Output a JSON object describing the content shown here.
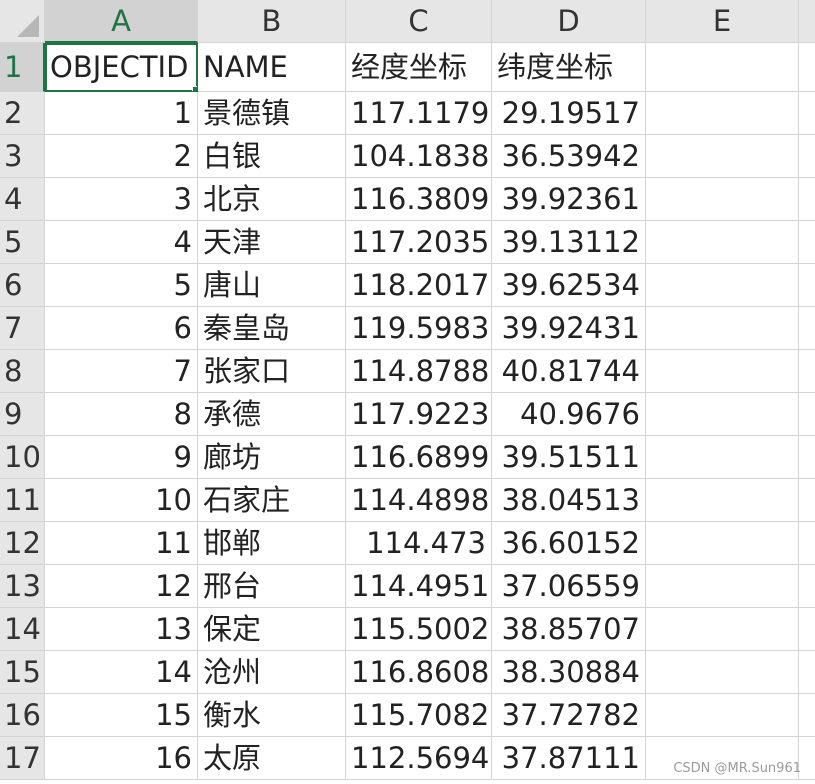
{
  "sheet": {
    "columns": [
      "A",
      "B",
      "C",
      "D",
      "E"
    ],
    "active_column": "A",
    "active_row": "1",
    "header_row": [
      "OBJECTID",
      "NAME",
      "经度坐标",
      "纬度坐标",
      ""
    ],
    "rows": [
      {
        "row": "2",
        "cells": [
          "1",
          "景德镇",
          "117.1179",
          "29.19517",
          ""
        ]
      },
      {
        "row": "3",
        "cells": [
          "2",
          "白银",
          "104.1838",
          "36.53942",
          ""
        ]
      },
      {
        "row": "4",
        "cells": [
          "3",
          "北京",
          "116.3809",
          "39.92361",
          ""
        ]
      },
      {
        "row": "5",
        "cells": [
          "4",
          "天津",
          "117.2035",
          "39.13112",
          ""
        ]
      },
      {
        "row": "6",
        "cells": [
          "5",
          "唐山",
          "118.2017",
          "39.62534",
          ""
        ]
      },
      {
        "row": "7",
        "cells": [
          "6",
          "秦皇岛",
          "119.5983",
          "39.92431",
          ""
        ]
      },
      {
        "row": "8",
        "cells": [
          "7",
          "张家口",
          "114.8788",
          "40.81744",
          ""
        ]
      },
      {
        "row": "9",
        "cells": [
          "8",
          "承德",
          "117.9223",
          "40.9676",
          ""
        ]
      },
      {
        "row": "10",
        "cells": [
          "9",
          "廊坊",
          "116.6899",
          "39.51511",
          ""
        ]
      },
      {
        "row": "11",
        "cells": [
          "10",
          "石家庄",
          "114.4898",
          "38.04513",
          ""
        ]
      },
      {
        "row": "12",
        "cells": [
          "11",
          "邯郸",
          "114.473",
          "36.60152",
          ""
        ]
      },
      {
        "row": "13",
        "cells": [
          "12",
          "邢台",
          "114.4951",
          "37.06559",
          ""
        ]
      },
      {
        "row": "14",
        "cells": [
          "13",
          "保定",
          "115.5002",
          "38.85707",
          ""
        ]
      },
      {
        "row": "15",
        "cells": [
          "14",
          "沧州",
          "116.8608",
          "38.30884",
          ""
        ]
      },
      {
        "row": "16",
        "cells": [
          "15",
          "衡水",
          "115.7082",
          "37.72782",
          ""
        ]
      },
      {
        "row": "17",
        "cells": [
          "16",
          "太原",
          "112.5694",
          "37.87111",
          ""
        ]
      }
    ]
  },
  "watermark": "CSDN @MR.Sun961",
  "colors": {
    "accent": "#217346",
    "header_bg": "#e6e6e6",
    "gridline": "#d4d4d4"
  }
}
